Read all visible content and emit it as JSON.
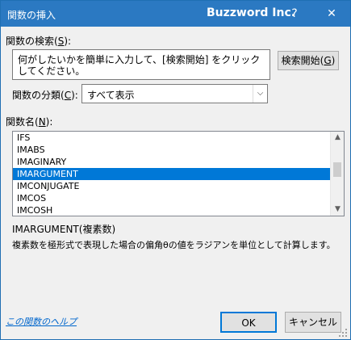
{
  "titlebar": {
    "title": "関数の挿入",
    "brand": "Buzzword Inc.",
    "help": "?",
    "close": "✕"
  },
  "search": {
    "label_prefix": "関数の検索(",
    "label_key": "S",
    "label_suffix": "):",
    "text": "何がしたいかを簡単に入力して、[検索開始] をクリックしてください。",
    "button_prefix": "検索開始(",
    "button_key": "G",
    "button_suffix": ")"
  },
  "category": {
    "label_prefix": "関数の分類(",
    "label_key": "C",
    "label_suffix": "):",
    "selected": "すべて表示"
  },
  "functions": {
    "label_prefix": "関数名(",
    "label_key": "N",
    "label_suffix": "):",
    "items": [
      "IFS",
      "IMABS",
      "IMAGINARY",
      "IMARGUMENT",
      "IMCONJUGATE",
      "IMCOS",
      "IMCOSH"
    ],
    "selected_index": 3
  },
  "detail": {
    "signature": "IMARGUMENT(複素数)",
    "description": "複素数を極形式で表現した場合の偏角θの値をラジアンを単位として計算します。"
  },
  "footer": {
    "help_link": "この関数のヘルプ",
    "ok": "OK",
    "cancel": "キャンセル"
  },
  "colors": {
    "titlebar": "#2b79c2",
    "selection": "#0078d7",
    "link": "#0066cc"
  }
}
